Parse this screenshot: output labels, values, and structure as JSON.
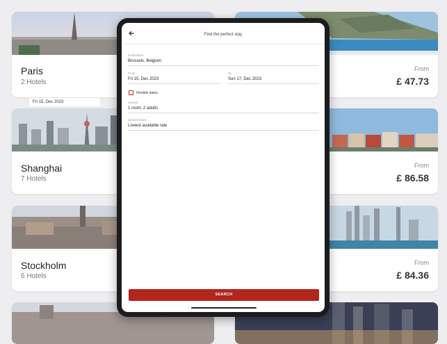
{
  "cards_left": [
    {
      "city": "Paris",
      "hotels": "2 Hotels"
    },
    {
      "city": "Shanghai",
      "hotels": "7 Hotels"
    },
    {
      "city": "Stockholm",
      "hotels": "6 Hotels"
    }
  ],
  "cards_right": [
    {
      "from": "From",
      "price": "£ 47.73"
    },
    {
      "from": "From",
      "price": "£ 86.58"
    },
    {
      "from": "From",
      "price": "£ 84.36"
    }
  ],
  "date_chip": "Fri 15, Dec 2023",
  "modal": {
    "title": "Find the perfect stay",
    "destination": {
      "label": "Destination",
      "value": "Brussels, Belgium"
    },
    "from": {
      "label": "From",
      "value": "Fri 15, Dec 2023"
    },
    "to": {
      "label": "To",
      "value": "Sun 17, Dec 2023"
    },
    "flexible_dates": "Flexible dates",
    "guests": {
      "label": "Guests",
      "value": "1 room, 2 adults"
    },
    "special_rates": {
      "label": "Special rates",
      "value": "Lowest available rate"
    },
    "search_label": "SEARCH"
  },
  "colors": {
    "accent": "#b3261e",
    "background": "#eeeef0",
    "device_frame": "#1c1c1e"
  },
  "icons": {
    "back": "back-arrow-icon"
  }
}
